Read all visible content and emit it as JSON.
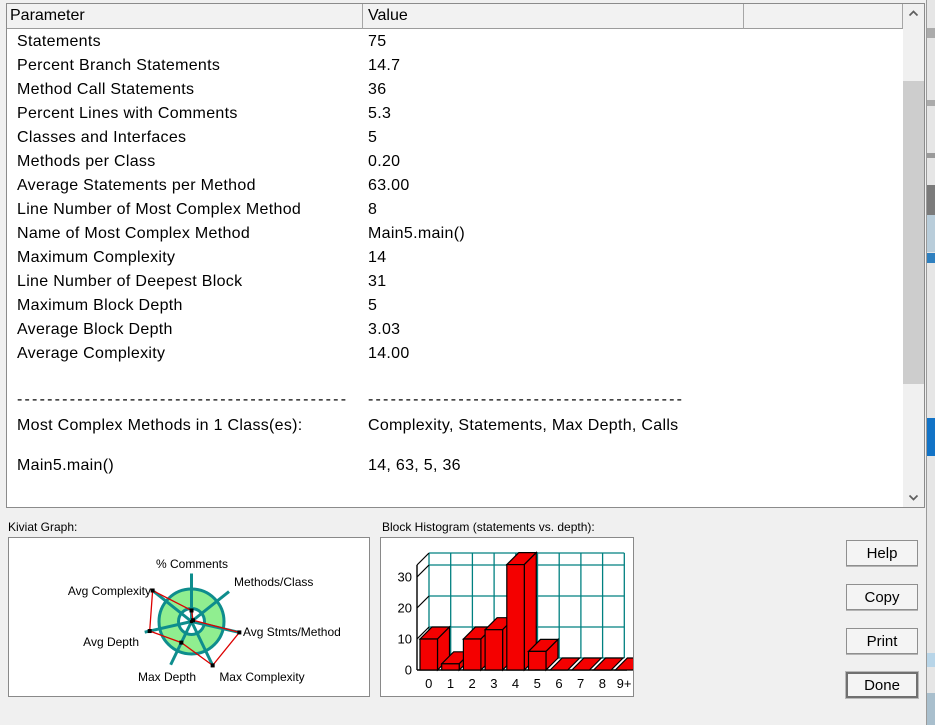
{
  "metrics_table": {
    "columns": [
      "Parameter",
      "Value",
      ""
    ],
    "rows": [
      {
        "param": "Statements",
        "value": "75"
      },
      {
        "param": "Percent Branch Statements",
        "value": "14.7"
      },
      {
        "param": "Method Call Statements",
        "value": "36"
      },
      {
        "param": "Percent Lines with Comments",
        "value": "5.3"
      },
      {
        "param": "Classes and Interfaces",
        "value": "5"
      },
      {
        "param": "Methods per Class",
        "value": "0.20"
      },
      {
        "param": "Average Statements per Method",
        "value": "63.00"
      },
      {
        "param": "Line Number of Most Complex Method",
        "value": "8"
      },
      {
        "param": "Name of Most Complex Method",
        "value": "Main5.main()"
      },
      {
        "param": "Maximum Complexity",
        "value": "14"
      },
      {
        "param": "Line Number of Deepest Block",
        "value": "31"
      },
      {
        "param": "Maximum Block Depth",
        "value": "5"
      },
      {
        "param": "Average Block Depth",
        "value": "3.03"
      },
      {
        "param": "Average Complexity",
        "value": "14.00"
      }
    ],
    "divider": {
      "param": "--------------------------------------------",
      "value": "------------------------------------------"
    },
    "most_complex_header": {
      "param": "Most Complex Methods in 1 Class(es):",
      "value": "Complexity, Statements, Max Depth, Calls"
    },
    "most_complex_row": {
      "param": "Main5.main()",
      "value": "14, 63, 5, 36"
    }
  },
  "kiviat": {
    "section_label": "Kiviat Graph:",
    "chart_data": {
      "type": "radar",
      "axes": [
        "% Comments",
        "Methods/Class",
        "Avg Stmts/Method",
        "Max Complexity",
        "Max Depth",
        "Avg Depth",
        "Avg Complexity"
      ],
      "values_fraction_of_outer_ring": [
        0.34,
        0.06,
        1.51,
        1.5,
        0.72,
        1.32,
        1.53
      ],
      "rings": {
        "inner_radius_frac": 0.4,
        "outer_radius_frac": 1.0
      },
      "colors": {
        "rings": "#0e8d8d",
        "band_fill": "#90ee90",
        "polygon": "#dc0000",
        "marker": "#000000"
      }
    }
  },
  "histogram": {
    "section_label": "Block Histogram (statements vs. depth):",
    "chart_data": {
      "type": "bar",
      "style": "3d",
      "categories": [
        "0",
        "1",
        "2",
        "3",
        "4",
        "5",
        "6",
        "7",
        "8",
        "9+"
      ],
      "values": [
        10,
        2,
        10,
        13,
        34,
        6,
        0,
        0,
        0,
        0
      ],
      "yticks": [
        0,
        10,
        20,
        30
      ],
      "ylim": [
        0,
        35
      ],
      "grid": true,
      "colors": {
        "bar": "#f40000",
        "grid": "#008080",
        "axis": "#000000"
      }
    }
  },
  "buttons": [
    {
      "label": "Help"
    },
    {
      "label": "Copy"
    },
    {
      "label": "Print"
    },
    {
      "label": "Done"
    }
  ],
  "icons": {
    "scroll_up": "chevron-up-icon",
    "scroll_down": "chevron-down-icon"
  }
}
